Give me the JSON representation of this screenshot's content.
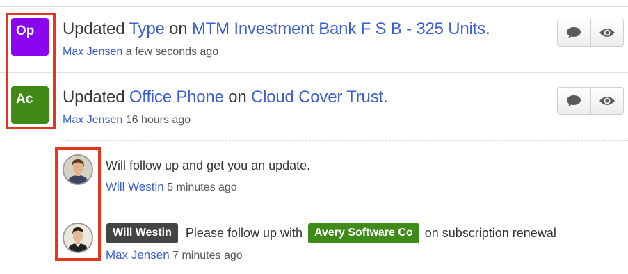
{
  "colors": {
    "link": "#3b5fd1",
    "highlight": "#e2371d",
    "badge_op": "#8a06f0",
    "badge_ac": "#3f8a14",
    "tag_user": "#444444",
    "tag_account": "#3e8b19"
  },
  "activities": [
    {
      "badge": "Op",
      "verb": "Updated",
      "field": "Type",
      "on": "on",
      "record": "MTM Investment Bank F S B - 325 Units",
      "period": ".",
      "author": "Max Jensen",
      "time": "a few seconds ago",
      "icons": [
        "comment-icon",
        "eye-icon"
      ]
    },
    {
      "badge": "Ac",
      "verb": "Updated",
      "field": "Office Phone",
      "on": "on",
      "record": "Cloud Cover Trust",
      "period": ".",
      "author": "Max Jensen",
      "time": "16 hours ago",
      "icons": [
        "comment-icon",
        "eye-icon"
      ],
      "comments": [
        {
          "text": "Will follow up and get you an update.",
          "author": "Will Westin",
          "time": "5 minutes ago",
          "avatar": "user-avatar"
        },
        {
          "mention_user": "Will Westin",
          "text_before": "Please follow up with",
          "mention_account": "Avery Software Co",
          "text_after": "on subscription renewal",
          "author": "Max Jensen",
          "time": "7 minutes ago",
          "avatar": "user-avatar"
        }
      ]
    }
  ]
}
